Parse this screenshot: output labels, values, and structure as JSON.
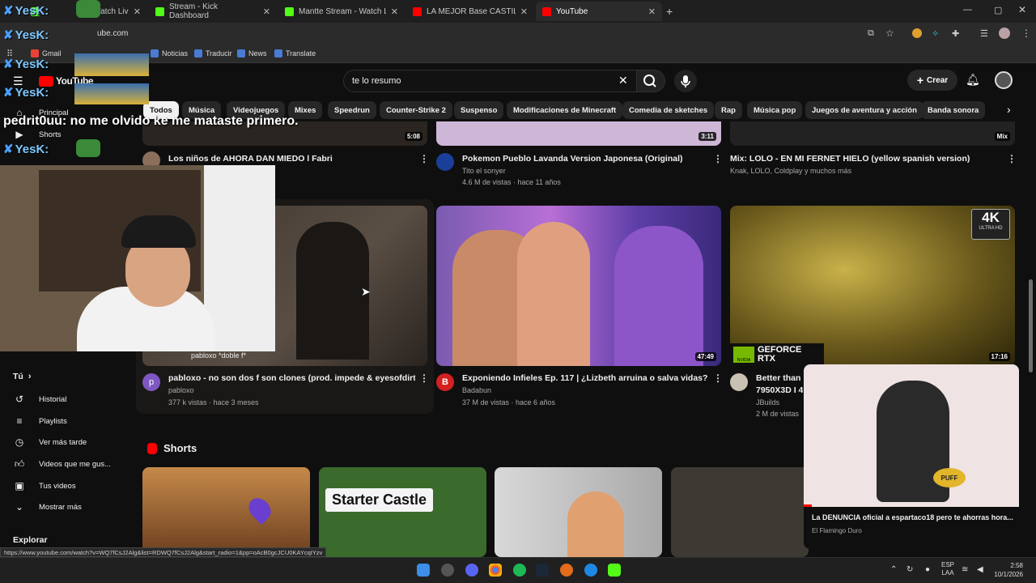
{
  "browser": {
    "tabs": [
      {
        "label": "Watch Liv",
        "active": false
      },
      {
        "label": "Stream - Kick Dashboard",
        "active": false
      },
      {
        "label": "Mantte Stream - Watch Live on",
        "active": false
      },
      {
        "label": "LA MEJOR Base CASTILLO para",
        "active": false
      },
      {
        "label": "YouTube",
        "active": true
      }
    ],
    "new_tab": "+",
    "url": "ube.com",
    "bookmarks": [
      "Gmail",
      "Noticias",
      "Traducir",
      "News",
      "Translate"
    ]
  },
  "youtube": {
    "logo": "YouTube",
    "search_value": "te lo resumo",
    "create_label": "Crear",
    "chips": [
      "Todos",
      "Música",
      "Videojuegos",
      "Mixes",
      "Speedrun",
      "Counter-Strike 2",
      "Suspenso",
      "Modificaciones de Minecraft",
      "Comedia de sketches",
      "Rap",
      "Música pop",
      "Juegos de aventura y acción",
      "Banda sonora"
    ]
  },
  "sidebar": {
    "items": [
      {
        "label": "Principal",
        "icon": "home-icon"
      },
      {
        "label": "Shorts",
        "icon": "shorts-icon"
      }
    ],
    "you_label": "Tú",
    "you_items": [
      {
        "label": "Historial",
        "icon": "history-icon"
      },
      {
        "label": "Playlists",
        "icon": "playlist-icon"
      },
      {
        "label": "Ver más tarde",
        "icon": "clock-icon"
      },
      {
        "label": "Videos que me gus...",
        "icon": "thumbs-up-icon"
      },
      {
        "label": "Tus videos",
        "icon": "video-icon"
      },
      {
        "label": "Mostrar más",
        "icon": "chevron-down-icon"
      }
    ],
    "explore_label": "Explorar"
  },
  "row1": [
    {
      "title": "Los niños de AHORA DAN MIEDO l Fabri",
      "duration": "5:08"
    },
    {
      "title": "Pokemon Pueblo Lavanda Version Japonesa (Original)",
      "channel": "Tito el sonyer",
      "meta": "4.6 M de vistas · hace 11 años",
      "duration": "3:11"
    },
    {
      "title": "Mix: LOLO - EN MI FERNET HIELO (yellow spanish version)",
      "channel": "Knak, LOLO, Coldplay y muchos más",
      "duration": "Mix"
    }
  ],
  "row2": [
    {
      "title": "pabloxo - no son dos f son clones (prod. impede & eyesofdirty)",
      "channel": "pabloxo",
      "meta": "377 k vistas · hace 3 meses",
      "avatar": "p",
      "overlay": "pabloxo *doble f*"
    },
    {
      "title": "Exponiendo Infieles Ep. 117 | ¿Lizbeth arruina o salva vidas?",
      "channel": "Badabun",
      "meta": "37 M de vistas · hace 6 años",
      "duration": "47:49",
      "avatar": "B"
    },
    {
      "title": "Better than N",
      "title2": "7950X3D I 4",
      "channel": "JBuilds",
      "meta": "2 M de vistas",
      "duration": "17:16",
      "badge": "4K",
      "badge_sub": "ULTRA HD",
      "brand": "GEFORCE",
      "brand2": "RTX",
      "brand3": "NVIDIA"
    }
  ],
  "shorts": {
    "heading": "Shorts",
    "items": [
      {
        "label": ""
      },
      {
        "label": "Starter Castle"
      },
      {
        "label": ""
      },
      {
        "label": ""
      }
    ]
  },
  "stream": {
    "chat_user": "pedrit0uu:",
    "chat_text": "no me olvido ke me mataste primero.",
    "badge_name": "YesK:"
  },
  "pip": {
    "title": "La DENUNCIA oficial a espartaco18 pero te ahorras hora...",
    "channel": "El Flamingo Duro",
    "sticker": "PUFF"
  },
  "status_url": "https://www.youtube.com/watch?v=WQ7fCsJ2Alg&list=RDWQ7fCsJ2Alg&start_radio=1&pp=oAcB0gcJCU0KAYcqIYzv",
  "taskbar": {
    "lang": "ESP",
    "lang2": "LAA",
    "time": "2:58",
    "date": "10/1/2026"
  },
  "colors": {
    "bg": "#0f0f0f",
    "youtube_red": "#ff0000",
    "kick_green": "#53fc18"
  }
}
